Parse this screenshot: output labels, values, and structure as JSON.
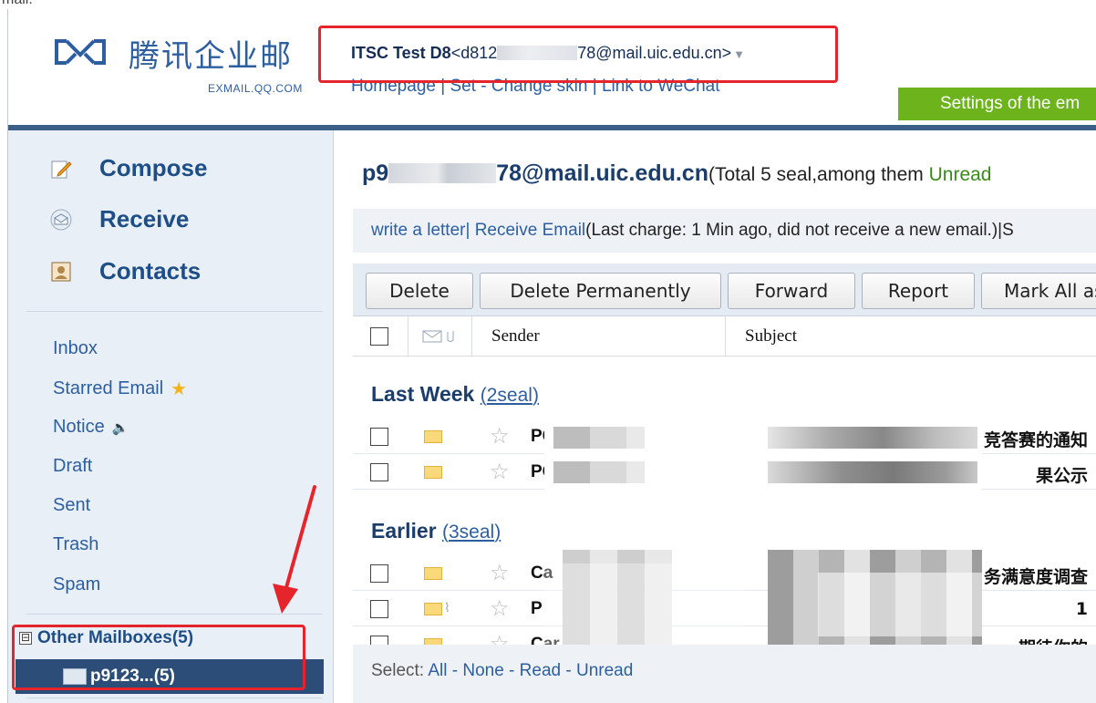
{
  "top_text": "mail.",
  "header": {
    "logo_name": "腾讯企业邮",
    "logo_domain": "EXMAIL.QQ.COM",
    "user_name": "ITSC  Test D8",
    "user_email_prefix": "<d812",
    "user_email_suffix": "78@mail.uic.edu.cn>",
    "user_caret": "▼",
    "links": "Homepage | Set - Change skin | Link to WeChat",
    "settings_banner": "Settings of the em"
  },
  "sidebar": {
    "compose": "Compose",
    "receive": "Receive",
    "contacts": "Contacts",
    "folders": [
      {
        "label": "Inbox"
      },
      {
        "label": "Starred Email",
        "extra": "★"
      },
      {
        "label": "Notice",
        "extra": "🔈"
      },
      {
        "label": "Draft"
      },
      {
        "label": "Sent"
      },
      {
        "label": "Trash"
      },
      {
        "label": "Spam"
      }
    ],
    "other_toggle": "⊟",
    "other_mailboxes": "Other Mailboxes(5)",
    "sub_mailbox": "p9123...(5)"
  },
  "main": {
    "title_prefix": "p9",
    "title_suffix": "78@mail.uic.edu.cn",
    "title_info": "(Total 5 seal,among them ",
    "title_unread": "Unread",
    "actions": {
      "write": "write a letter",
      "receive": "| Receive Email",
      "status": "(Last charge: 1 Min ago, did not receive a new email.)|S"
    },
    "toolbar": {
      "delete": "Delete",
      "delete_permanently": "Delete Permanently",
      "forward": "Forward",
      "report": "Report",
      "mark_all": "Mark All as"
    },
    "columns": {
      "sender": "Sender",
      "subject": "Subject"
    },
    "groups": [
      {
        "label": "Last Week",
        "count": "2seal",
        "rows": [
          {
            "sender": "PC",
            "subject": "竞答赛的通知",
            "sep": "-"
          },
          {
            "sender": "PC",
            "subject": "果公示",
            "sep": "-"
          }
        ]
      },
      {
        "label": "Earlier",
        "count": "3seal",
        "rows": [
          {
            "sender": "Ca",
            "subject": "务满意度调查",
            "sep": "-"
          },
          {
            "sender": "P",
            "subject": "1",
            "sep": ""
          },
          {
            "sender": "Car",
            "subject": "期待你的",
            "sep": ""
          }
        ]
      }
    ],
    "select": {
      "label": "Select:",
      "all": "All",
      "none": "None",
      "read": "Read",
      "unread": "Unread"
    }
  },
  "colors": {
    "brand_blue": "#2d5fa0",
    "header_rule": "#3c5f88",
    "settings_green": "#6cb31c",
    "annotation_red": "#e5242c",
    "sidebar_bg": "#e9eff6"
  }
}
